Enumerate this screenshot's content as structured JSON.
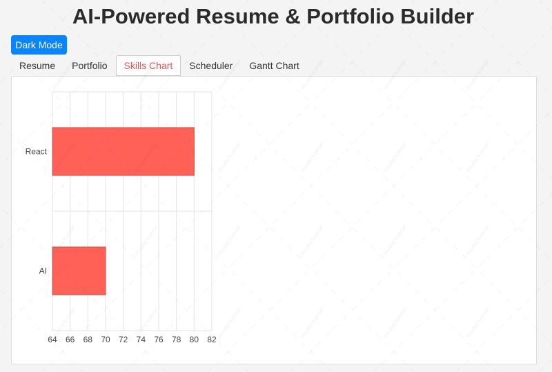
{
  "header": {
    "title": "AI-Powered Resume & Portfolio Builder"
  },
  "toolbar": {
    "dark_mode_label": "Dark Mode"
  },
  "tabs": [
    {
      "label": "Resume",
      "active": false
    },
    {
      "label": "Portfolio",
      "active": false
    },
    {
      "label": "Skills Chart",
      "active": true
    },
    {
      "label": "Scheduler",
      "active": false
    },
    {
      "label": "Gantt Chart",
      "active": false
    }
  ],
  "watermark": {
    "text": "Invalid license"
  },
  "colors": {
    "accent": "#0a84ff",
    "active_tab": "#e8554e",
    "bar_fill": "#ff6157",
    "bar_stroke": "#c9504a"
  },
  "chart_data": {
    "type": "bar",
    "orientation": "horizontal",
    "categories": [
      "React",
      "AI"
    ],
    "values": [
      80,
      70
    ],
    "xlim": [
      64,
      82
    ],
    "xticks": [
      64,
      66,
      68,
      70,
      72,
      74,
      76,
      78,
      80,
      82
    ],
    "grid": true,
    "title": "",
    "xlabel": "",
    "ylabel": ""
  }
}
